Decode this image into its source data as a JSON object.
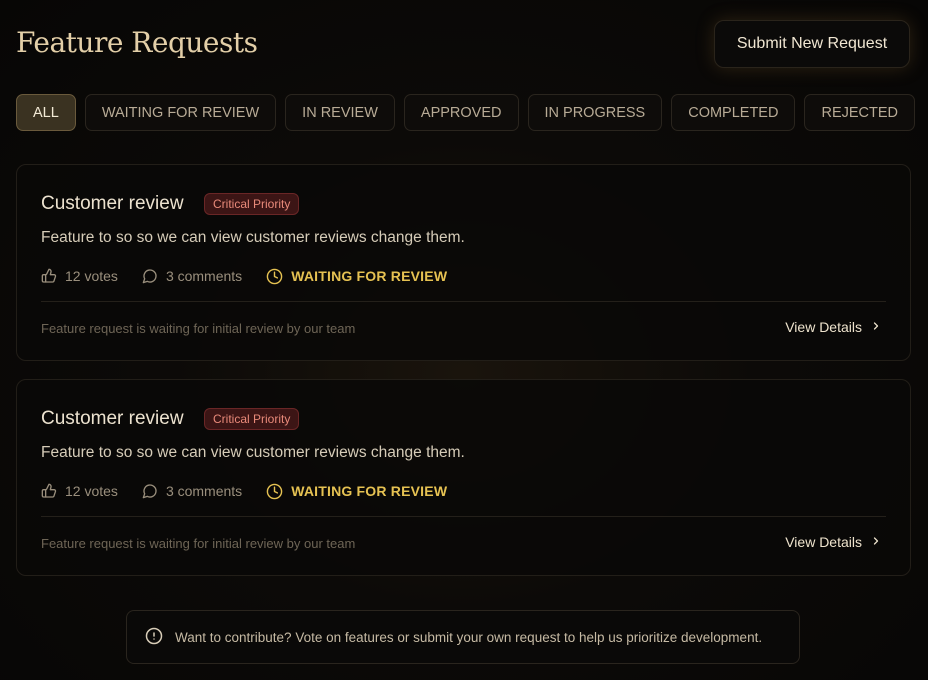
{
  "page": {
    "title": "Feature Requests"
  },
  "header": {
    "submit_label": "Submit New Request"
  },
  "tabs": [
    {
      "label": "ALL",
      "active": true
    },
    {
      "label": "WAITING FOR REVIEW",
      "active": false
    },
    {
      "label": "IN REVIEW",
      "active": false
    },
    {
      "label": "APPROVED",
      "active": false
    },
    {
      "label": "IN PROGRESS",
      "active": false
    },
    {
      "label": "COMPLETED",
      "active": false
    },
    {
      "label": "REJECTED",
      "active": false
    }
  ],
  "requests": [
    {
      "title": "Customer review",
      "priority": "Critical Priority",
      "description": "Feature to so so we can view customer reviews change them.",
      "votes": "12 votes",
      "comments": "3 comments",
      "status": "WAITING FOR REVIEW",
      "note": "Feature request is waiting for initial review by our team",
      "action": "View Details"
    },
    {
      "title": "Customer review",
      "priority": "Critical Priority",
      "description": "Feature to so so we can view customer reviews change them.",
      "votes": "12 votes",
      "comments": "3 comments",
      "status": "WAITING FOR REVIEW",
      "note": "Feature request is waiting for initial review by our team",
      "action": "View Details"
    }
  ],
  "info": {
    "text": "Want to contribute? Vote on features or submit your own request to help us prioritize development."
  },
  "icons": {
    "votes": "thumbs-up-icon",
    "comments": "comment-icon",
    "status": "clock-icon",
    "action": "chevron-right-icon",
    "info": "info-icon"
  },
  "colors": {
    "title": "#e3cfa8",
    "status": "#e6c252",
    "priority_bg": "#3c1515",
    "priority_text": "#e98a7a",
    "active_tab_bg": "#3a3221"
  }
}
